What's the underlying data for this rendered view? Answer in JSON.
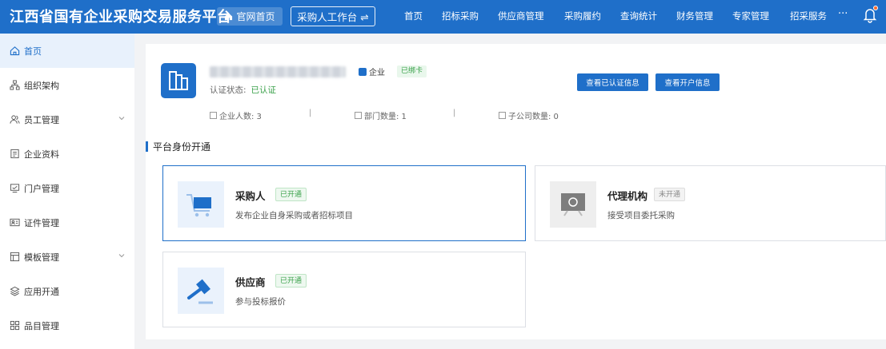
{
  "header": {
    "title": "江西省国有企业采购交易服务平台",
    "home_button": "官网首页",
    "workbench_button": "采购人工作台 ⇌",
    "nav": [
      "首页",
      "招标采购",
      "供应商管理",
      "采购履约",
      "查询统计",
      "财务管理",
      "专家管理",
      "招采服务"
    ],
    "more": "···"
  },
  "sidebar": {
    "items": [
      {
        "label": "首页",
        "icon": "home-icon",
        "active": true
      },
      {
        "label": "组织架构",
        "icon": "org-chart-icon"
      },
      {
        "label": "员工管理",
        "icon": "people-icon",
        "expandable": true
      },
      {
        "label": "企业资料",
        "icon": "document-icon"
      },
      {
        "label": "门户管理",
        "icon": "monitor-icon"
      },
      {
        "label": "证件管理",
        "icon": "id-card-icon"
      },
      {
        "label": "模板管理",
        "icon": "template-icon",
        "expandable": true
      },
      {
        "label": "应用开通",
        "icon": "app-icon"
      },
      {
        "label": "品目管理",
        "icon": "grid-icon"
      }
    ]
  },
  "company": {
    "type_badge": "企业",
    "bound_badge": "已绑卡",
    "cert_label": "认证状态:",
    "cert_value": "已认证",
    "btn_view_cert": "查看已认证信息",
    "btn_view_account": "查看开户信息",
    "stats": [
      {
        "label": "企业人数: 3"
      },
      {
        "label": "部门数量: 1"
      },
      {
        "label": "子公司数量: 0"
      }
    ],
    "separator": "|"
  },
  "identity": {
    "section_title": "平台身份开通",
    "cards": [
      {
        "title": "采购人",
        "status": "已开通",
        "desc": "发布企业自身采购或者招标项目",
        "icon": "cart-icon"
      },
      {
        "title": "代理机构",
        "status": "未开通",
        "desc": "接受项目委托采购",
        "icon": "agency-icon"
      },
      {
        "title": "供应商",
        "status": "已开通",
        "desc": "参与投标报价",
        "icon": "gavel-icon"
      }
    ]
  },
  "colors": {
    "primary": "#1f6fc9",
    "success": "#3aa14a",
    "notify": "#ff6a2b"
  }
}
